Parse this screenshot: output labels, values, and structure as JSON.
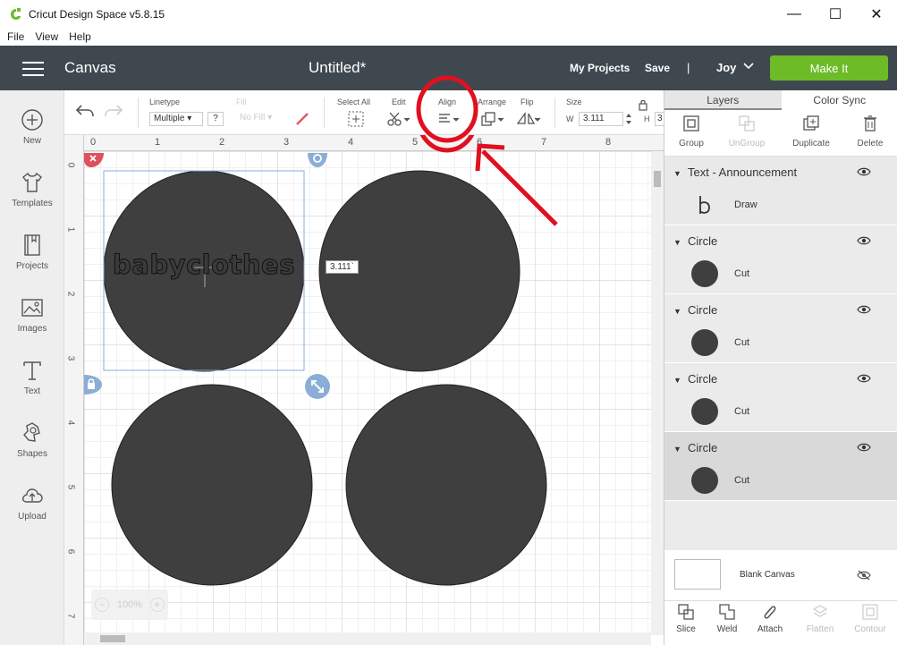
{
  "window": {
    "title": "Cricut Design Space  v5.8.15",
    "minimize": "—",
    "maximize": "☐",
    "close": "✕"
  },
  "menu": [
    "File",
    "View",
    "Help"
  ],
  "header": {
    "section": "Canvas",
    "doc_title": "Untitled*",
    "my_projects": "My Projects",
    "save": "Save",
    "separator": "|",
    "user": "Joy",
    "make_it": "Make It"
  },
  "sidebar": [
    "New",
    "Templates",
    "Projects",
    "Images",
    "Text",
    "Shapes",
    "Upload"
  ],
  "toolbar": {
    "linetype_label": "Linetype",
    "linetype_value": "Multiple",
    "linetype_help": "?",
    "fill_label": "Fill",
    "fill_value": "No Fill",
    "select_all": "Select All",
    "edit": "Edit",
    "align": "Align",
    "arrange": "Arrange",
    "flip": "Flip",
    "size_label": "Size",
    "w_label": "W",
    "w_value": "3.111",
    "h_label": "H",
    "h_value": "3"
  },
  "canvas": {
    "ruler_top": [
      "0",
      "1",
      "2",
      "3",
      "4",
      "5",
      "6",
      "7",
      "8"
    ],
    "ruler_left": [
      "0",
      "1",
      "2",
      "3",
      "4",
      "5",
      "6",
      "7"
    ],
    "text_object": "babyclothes",
    "size_tooltip": "3.111`",
    "zoom": "100%",
    "zoom_minus": "−",
    "zoom_plus": "+"
  },
  "panel": {
    "tabs": [
      "Layers",
      "Color Sync"
    ],
    "actions": [
      "Group",
      "UnGroup",
      "Duplicate",
      "Delete"
    ],
    "layers": [
      {
        "name": "Text - Announcement",
        "child": "Draw"
      },
      {
        "name": "Circle",
        "child": "Cut"
      },
      {
        "name": "Circle",
        "child": "Cut"
      },
      {
        "name": "Circle",
        "child": "Cut"
      },
      {
        "name": "Circle",
        "child": "Cut"
      }
    ],
    "blank_canvas": "Blank Canvas",
    "bottom": [
      "Slice",
      "Weld",
      "Attach",
      "Flatten",
      "Contour"
    ]
  },
  "colors": {
    "header": "#3f484f",
    "make_it": "#6cbb27",
    "shape": "#3f3f3f",
    "annotation": "#e01020",
    "handle": "#8aaed6",
    "handle_delete": "#e0505f"
  }
}
